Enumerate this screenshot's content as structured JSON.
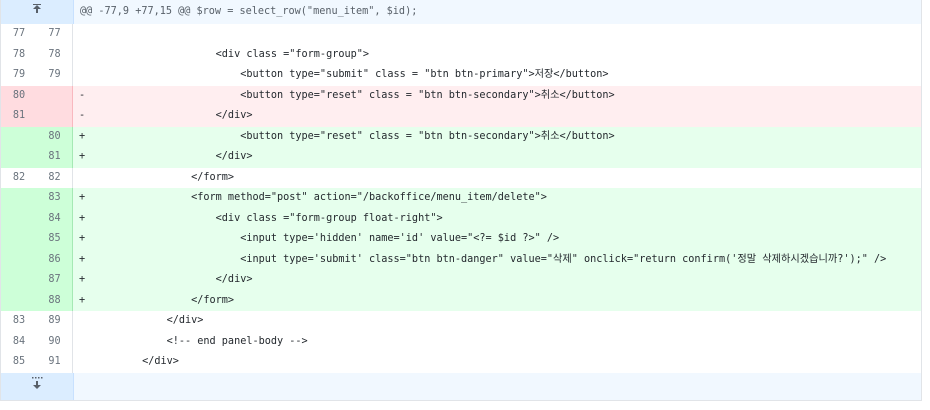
{
  "hunk_header": "@@ -77,9 +77,15 @@ $row = select_row(\"menu_item\", $id);",
  "expand_up_icon": "expand-up-icon",
  "expand_down_icon": "expand-down-icon",
  "lines": [
    {
      "type": "ctx",
      "old": "77",
      "new": "77",
      "sign": "",
      "text": ""
    },
    {
      "type": "ctx",
      "old": "78",
      "new": "78",
      "sign": "",
      "text": "                    <div class =\"form-group\">"
    },
    {
      "type": "ctx",
      "old": "79",
      "new": "79",
      "sign": "",
      "text": "                        <button type=\"submit\" class = \"btn btn-primary\">저장</button>"
    },
    {
      "type": "del",
      "old": "80",
      "new": "",
      "sign": "-",
      "text": "                        <button type=\"reset\" class = \"btn btn-secondary\">취소</button>"
    },
    {
      "type": "del",
      "old": "81",
      "new": "",
      "sign": "-",
      "text": "                    </div>"
    },
    {
      "type": "add",
      "old": "",
      "new": "80",
      "sign": "+",
      "text": "                        <button type=\"reset\" class = \"btn btn-secondary\">취소</button>"
    },
    {
      "type": "add",
      "old": "",
      "new": "81",
      "sign": "+",
      "text": "                    </div>"
    },
    {
      "type": "ctx",
      "old": "82",
      "new": "82",
      "sign": "",
      "text": "                </form>"
    },
    {
      "type": "add",
      "old": "",
      "new": "83",
      "sign": "+",
      "text": "                <form method=\"post\" action=\"/backoffice/menu_item/delete\">"
    },
    {
      "type": "add",
      "old": "",
      "new": "84",
      "sign": "+",
      "text": "                    <div class =\"form-group float-right\">"
    },
    {
      "type": "add",
      "old": "",
      "new": "85",
      "sign": "+",
      "text": "                        <input type='hidden' name='id' value=\"<?= $id ?>\" />"
    },
    {
      "type": "add",
      "old": "",
      "new": "86",
      "sign": "+",
      "text": "                        <input type='submit' class=\"btn btn-danger\" value=\"삭제\" onclick=\"return confirm('정말 삭제하시겠습니까?');\" />"
    },
    {
      "type": "add",
      "old": "",
      "new": "87",
      "sign": "+",
      "text": "                    </div>"
    },
    {
      "type": "add",
      "old": "",
      "new": "88",
      "sign": "+",
      "text": "                </form>"
    },
    {
      "type": "ctx",
      "old": "83",
      "new": "89",
      "sign": "",
      "text": "            </div>"
    },
    {
      "type": "ctx",
      "old": "84",
      "new": "90",
      "sign": "",
      "text": "            <!-- end panel-body -->"
    },
    {
      "type": "ctx",
      "old": "85",
      "new": "91",
      "sign": "",
      "text": "        </div>"
    }
  ]
}
